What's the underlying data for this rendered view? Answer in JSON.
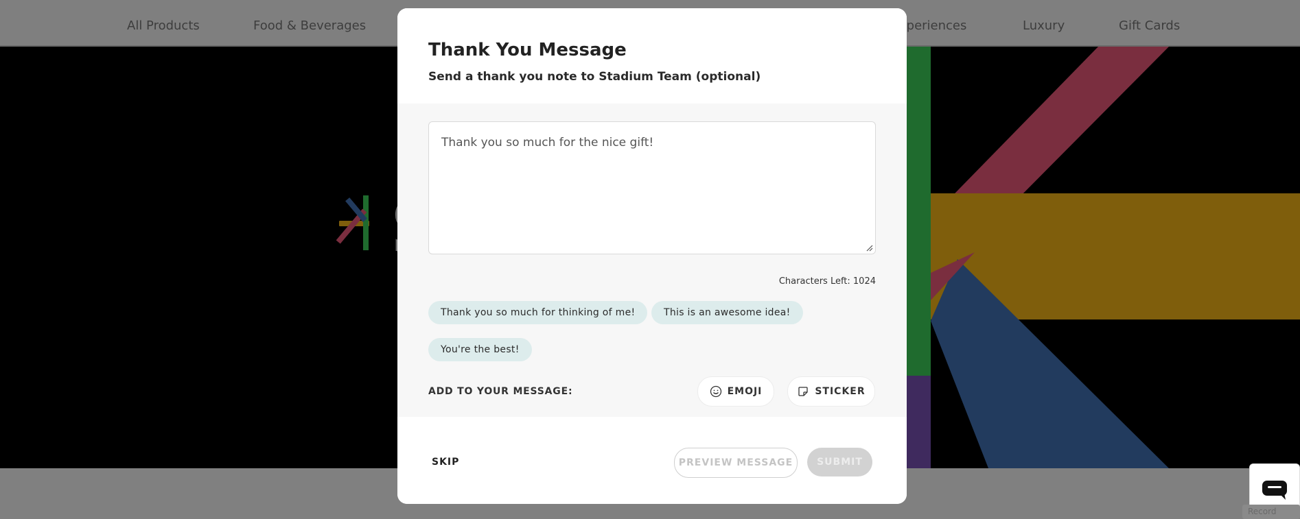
{
  "nav": {
    "items": [
      "All Products",
      "Food & Beverages",
      "xperiences",
      "Luxury",
      "Gift Cards"
    ]
  },
  "modal": {
    "title": "Thank You Message",
    "subtitle": "Send a thank you note to Stadium Team (optional)",
    "message_placeholder": "Thank you so much for the nice gift!",
    "characters_left": "Characters Left: 1024",
    "suggestions": [
      "Thank you so much for thinking of me!",
      "This is an awesome idea!",
      "You're the best!"
    ],
    "add_label": "ADD TO YOUR MESSAGE:",
    "emoji_label": "EMOJI",
    "sticker_label": "STICKER",
    "skip_label": "SKIP",
    "preview_label": "PREVIEW MESSAGE",
    "submit_label": "SUBMIT"
  },
  "recorder_label": "Record",
  "colors": {
    "overlay": "#808080",
    "chip_bg": "#ddecec",
    "stripe_green": "#1f6b2e",
    "stripe_red": "#7a2e3f",
    "stripe_gold": "#7f5e0c",
    "stripe_blue": "#223b5e",
    "stripe_purple": "#3f2a5e"
  },
  "icons": [
    "smiley-icon",
    "sticker-icon",
    "chat-icon",
    "resize-handle-icon"
  ]
}
